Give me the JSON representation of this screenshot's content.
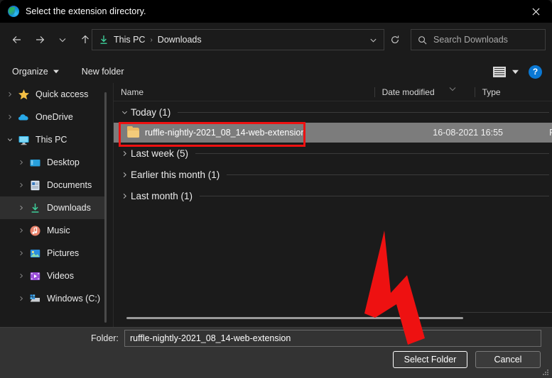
{
  "window": {
    "title": "Select the extension directory.",
    "app_icon": "edge-icon",
    "close_icon": "close-icon"
  },
  "nav": {
    "back_icon": "back-arrow-icon",
    "forward_icon": "forward-arrow-icon",
    "recent_icon": "chevron-down-icon",
    "up_icon": "up-arrow-icon",
    "refresh_icon": "refresh-icon",
    "address": {
      "icon": "downloads-icon",
      "crumbs": [
        "This PC",
        "Downloads"
      ],
      "separator": "›",
      "caret_icon": "chevron-down-icon"
    },
    "search": {
      "icon": "search-icon",
      "placeholder": "Search Downloads",
      "value": ""
    }
  },
  "commandbar": {
    "organize_label": "Organize",
    "organize_caret": "caret-down-icon",
    "new_folder_label": "New folder",
    "view_icon": "view-layout-icon",
    "view_caret": "caret-down-icon",
    "help_label": "?"
  },
  "sidebar": {
    "items": [
      {
        "label": "Quick access",
        "icon": "star-icon",
        "indent": false,
        "selected": false,
        "expanded": false
      },
      {
        "label": "OneDrive",
        "icon": "cloud-icon",
        "indent": false,
        "selected": false,
        "expanded": false
      },
      {
        "label": "This PC",
        "icon": "monitor-icon",
        "indent": false,
        "selected": false,
        "expanded": true
      },
      {
        "label": "Desktop",
        "icon": "desktop-icon",
        "indent": true,
        "selected": false,
        "expanded": false
      },
      {
        "label": "Documents",
        "icon": "documents-icon",
        "indent": true,
        "selected": false,
        "expanded": false
      },
      {
        "label": "Downloads",
        "icon": "downloads-icon",
        "indent": true,
        "selected": true,
        "expanded": false
      },
      {
        "label": "Music",
        "icon": "music-icon",
        "indent": true,
        "selected": false,
        "expanded": false
      },
      {
        "label": "Pictures",
        "icon": "pictures-icon",
        "indent": true,
        "selected": false,
        "expanded": false
      },
      {
        "label": "Videos",
        "icon": "videos-icon",
        "indent": true,
        "selected": false,
        "expanded": false
      },
      {
        "label": "Windows (C:)",
        "icon": "drive-icon",
        "indent": true,
        "selected": false,
        "expanded": false
      }
    ]
  },
  "filelist": {
    "columns": [
      "Name",
      "Date modified",
      "Type"
    ],
    "sort_indicator": "chevron-down-icon",
    "groups": [
      {
        "label": "Today (1)",
        "expanded": true,
        "rows": [
          {
            "name": "ruffle-nightly-2021_08_14-web-extension",
            "date": "16-08-2021 16:55",
            "type": "File folder",
            "icon": "folder-icon",
            "selected": true
          }
        ]
      },
      {
        "label": "Last week (5)",
        "expanded": false,
        "rows": []
      },
      {
        "label": "Earlier this month (1)",
        "expanded": false,
        "rows": []
      },
      {
        "label": "Last month (1)",
        "expanded": false,
        "rows": []
      }
    ]
  },
  "footer": {
    "folder_label": "Folder:",
    "folder_value": "ruffle-nightly-2021_08_14-web-extension",
    "select_label": "Select Folder",
    "cancel_label": "Cancel",
    "resize_grip": "resize-grip-icon"
  },
  "annotations": {
    "highlight_target": "ruffle-nightly-2021_08_14-web-extension",
    "arrow_target": "Select Folder",
    "color": "#ee1111"
  }
}
